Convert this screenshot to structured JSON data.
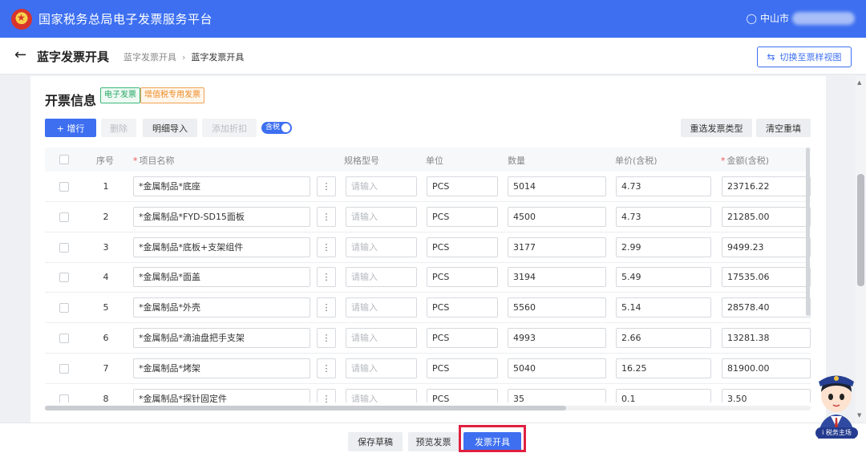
{
  "header": {
    "app_title": "国家税务总局电子发票服务平台",
    "user_location": "中山市"
  },
  "subheader": {
    "page_title": "蓝字发票开具",
    "breadcrumb": [
      "蓝字发票开具",
      "蓝字发票开具"
    ],
    "switch_view_label": "切换至票样视图"
  },
  "invoice_section": {
    "title": "开票信息",
    "tags": [
      "电子发票",
      "增值税专用发票"
    ],
    "toolbar": {
      "add_row": "+ 增行",
      "delete": "删除",
      "import_detail": "明细导入",
      "add_discount": "添加折扣",
      "tax_included_toggle": "含税",
      "reselect_type": "重选发票类型",
      "clear_refill": "清空重填"
    },
    "columns": [
      "序号",
      "项目名称",
      "规格型号",
      "单位",
      "数量",
      "单价(含税)",
      "金额(含税)"
    ],
    "required_columns": [
      "项目名称",
      "金额(含税)"
    ],
    "spec_placeholder": "请输入",
    "rows": [
      {
        "seq": "1",
        "name": "*金属制品*底座",
        "unit": "PCS",
        "qty": "5014",
        "price": "4.73",
        "amount": "23716.22"
      },
      {
        "seq": "2",
        "name": "*金属制品*FYD-SD15面板",
        "unit": "PCS",
        "qty": "4500",
        "price": "4.73",
        "amount": "21285.00"
      },
      {
        "seq": "3",
        "name": "*金属制品*底板+支架组件",
        "unit": "PCS",
        "qty": "3177",
        "price": "2.99",
        "amount": "9499.23"
      },
      {
        "seq": "4",
        "name": "*金属制品*面盖",
        "unit": "PCS",
        "qty": "3194",
        "price": "5.49",
        "amount": "17535.06"
      },
      {
        "seq": "5",
        "name": "*金属制品*外壳",
        "unit": "PCS",
        "qty": "5560",
        "price": "5.14",
        "amount": "28578.40"
      },
      {
        "seq": "6",
        "name": "*金属制品*滴油盘把手支架",
        "unit": "PCS",
        "qty": "4993",
        "price": "2.66",
        "amount": "13281.38"
      },
      {
        "seq": "7",
        "name": "*金属制品*烤架",
        "unit": "PCS",
        "qty": "5040",
        "price": "16.25",
        "amount": "81900.00"
      },
      {
        "seq": "8",
        "name": "*金属制品*探针固定件",
        "unit": "PCS",
        "qty": "35",
        "price": "0.1",
        "amount": "3.50"
      }
    ]
  },
  "footer": {
    "save_draft": "保存草稿",
    "preview": "预览发票",
    "issue": "发票开具"
  },
  "mascot": {
    "badge": "i 税务主场"
  },
  "colors": {
    "primary": "#3d6ff0",
    "highlight": "#e02040",
    "tag_green": "#29a566",
    "tag_orange": "#ec8c28"
  },
  "icons": {
    "back": "arrow-left-icon",
    "user": "user-icon",
    "switch": "swap-icon",
    "more": "more-vertical-icon"
  }
}
